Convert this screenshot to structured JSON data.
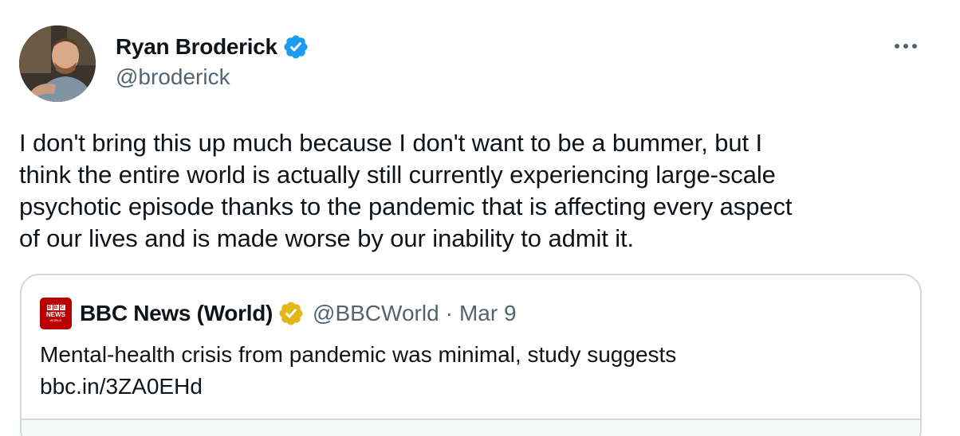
{
  "tweet": {
    "author": {
      "name": "Ryan Broderick",
      "handle": "@broderick",
      "verified_icon": "verified-badge-icon",
      "verified_color": "#1d9bf0"
    },
    "text_lines": [
      "I don't bring this up much because I don't want to be a bummer, but I",
      "think the entire world is actually still currently experiencing large-scale",
      "psychotic episode thanks to the pandemic that is affecting every aspect",
      "of our lives and is made worse by our inability to admit it."
    ],
    "more_icon": "more-options-icon"
  },
  "quote": {
    "avatar_icon": "bbc-news-logo",
    "avatar_text": {
      "letters": [
        "B",
        "B",
        "C"
      ],
      "word": "NEWS",
      "sub": "WORLD"
    },
    "name": "BBC News (World)",
    "verified_icon": "gold-verified-badge-icon",
    "verified_color": "#e2b719",
    "handle": "@BBCWorld",
    "separator": "·",
    "date": "Mar 9",
    "text": "Mental-health crisis from pandemic was minimal, study suggests",
    "link": "bbc.in/3ZA0EHd"
  },
  "colors": {
    "text_primary": "#0f1419",
    "text_secondary": "#536471",
    "border": "#cfd9de",
    "bbc_red": "#b80000"
  }
}
